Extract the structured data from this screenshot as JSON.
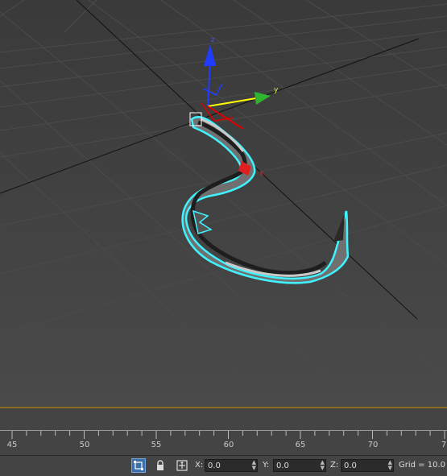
{
  "viewport": {
    "gizmo_axes": {
      "x": "x",
      "y": "y",
      "z": "z"
    },
    "colors": {
      "selection_outline": "#3ff4ff",
      "gizmo_x": "#e02020",
      "gizmo_y": "#2fb52f",
      "gizmo_z": "#1f3cff",
      "gizmo_xy_plane": "#ffff00"
    }
  },
  "timeline": {
    "ruler_labels": [
      "45",
      "50",
      "55",
      "60",
      "65",
      "70",
      "7"
    ]
  },
  "statusbar": {
    "x_label": "X:",
    "x_value": "0.0",
    "y_label": "Y:",
    "y_value": "0.0",
    "z_label": "Z:",
    "z_value": "0.0",
    "grid_text": "Grid = 10.0",
    "icons": [
      "selection-lock-icon",
      "lock-icon",
      "absolute-mode-icon"
    ]
  }
}
